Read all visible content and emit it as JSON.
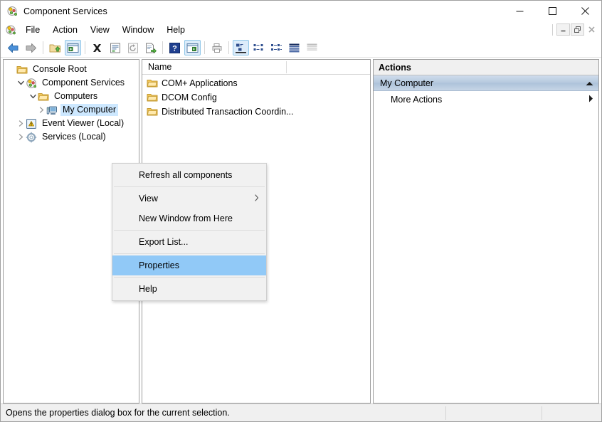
{
  "window": {
    "title": "Component Services",
    "icon": "component-services-icon",
    "controls": {
      "minimize": "minimize",
      "maximize": "maximize",
      "close": "close"
    }
  },
  "menubar": {
    "icon": "component-services-icon",
    "items": [
      {
        "label": "File"
      },
      {
        "label": "Action"
      },
      {
        "label": "View"
      },
      {
        "label": "Window"
      },
      {
        "label": "Help"
      }
    ],
    "mdi_controls": {
      "minimize": "minimize",
      "restore": "restore",
      "close": "close"
    }
  },
  "toolbar": {
    "buttons": [
      {
        "name": "back-icon",
        "enabled": true
      },
      {
        "name": "forward-icon",
        "enabled": true
      },
      {
        "name": "up-one-level-icon",
        "enabled": true
      },
      {
        "name": "show-hide-console-tree-icon",
        "enabled": true,
        "active": true
      },
      {
        "name": "delete-icon",
        "enabled": true
      },
      {
        "name": "properties-icon",
        "enabled": true
      },
      {
        "name": "refresh-icon",
        "enabled": false
      },
      {
        "name": "export-list-icon",
        "enabled": true
      },
      {
        "name": "help-icon",
        "enabled": true
      },
      {
        "name": "new-window-icon",
        "enabled": true,
        "active": true
      },
      {
        "name": "print-icon",
        "enabled": false
      },
      {
        "name": "view-large-icons-icon",
        "enabled": true,
        "active": true
      },
      {
        "name": "view-small-icons-icon",
        "enabled": true
      },
      {
        "name": "view-list-icon",
        "enabled": true
      },
      {
        "name": "view-details-icon",
        "enabled": true
      },
      {
        "name": "view-extra-icon",
        "enabled": false
      }
    ]
  },
  "tree": {
    "nodes": [
      {
        "label": "Console Root",
        "indent": 0,
        "icon": "folder-icon",
        "twisty": "none",
        "selected": false
      },
      {
        "label": "Component Services",
        "indent": 1,
        "icon": "component-services-icon",
        "twisty": "expanded",
        "selected": false
      },
      {
        "label": "Computers",
        "indent": 2,
        "icon": "folder-icon",
        "twisty": "expanded",
        "selected": false
      },
      {
        "label": "My Computer",
        "indent": 3,
        "icon": "computer-icon",
        "twisty": "collapsed",
        "selected": true
      },
      {
        "label": "Event Viewer (Local)",
        "indent": 1,
        "icon": "event-viewer-icon",
        "twisty": "collapsed",
        "selected": false
      },
      {
        "label": "Services (Local)",
        "indent": 1,
        "icon": "services-icon",
        "twisty": "collapsed",
        "selected": false
      }
    ]
  },
  "list": {
    "columns": [
      "Name"
    ],
    "rows": [
      {
        "name": "COM+ Applications",
        "icon": "folder-icon"
      },
      {
        "name": "DCOM Config",
        "icon": "folder-icon"
      },
      {
        "name": "Distributed Transaction Coordin...",
        "icon": "folder-icon",
        "truncated_visible": "din..."
      }
    ]
  },
  "actions": {
    "header": "Actions",
    "group": {
      "label": "My Computer",
      "chevron": "chevron-up-icon"
    },
    "items": [
      {
        "label": "More Actions",
        "arrow": "chevron-right-icon"
      }
    ]
  },
  "context_menu": {
    "items": [
      {
        "label": "Refresh all components",
        "type": "item"
      },
      {
        "type": "separator"
      },
      {
        "label": "View",
        "type": "item",
        "submenu": true
      },
      {
        "label": "New Window from Here",
        "type": "item"
      },
      {
        "type": "separator"
      },
      {
        "label": "Export List...",
        "type": "item"
      },
      {
        "type": "separator"
      },
      {
        "label": "Properties",
        "type": "item",
        "highlighted": true
      },
      {
        "type": "separator"
      },
      {
        "label": "Help",
        "type": "item"
      }
    ]
  },
  "statusbar": {
    "text": "Opens the properties dialog box for the current selection."
  },
  "colors": {
    "menu_highlight": "#91c9f7",
    "tree_selection": "#cde8ff",
    "actions_group": "#b6c9de",
    "toolbar_active": "#dcecfa"
  }
}
